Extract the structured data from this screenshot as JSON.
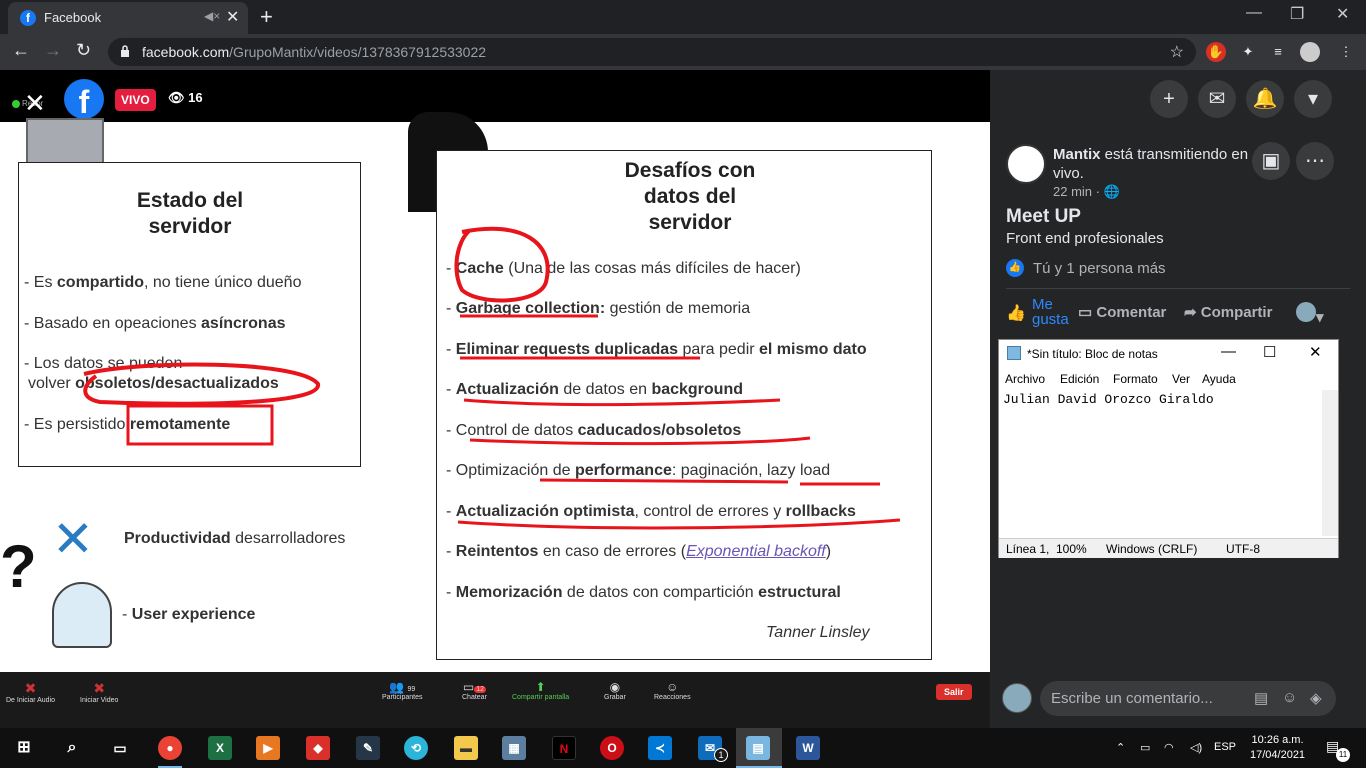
{
  "browser": {
    "tab_title": "Facebook",
    "url_domain": "facebook.com",
    "url_path": "/GrupoMantix/videos/1378367912533022"
  },
  "video": {
    "live_badge": "VIVO",
    "viewer_count": "16",
    "recording_label": "Recor"
  },
  "slide": {
    "left_title": "Estado del\nservidor",
    "left_items": [
      [
        "- Es ",
        "compartido",
        ", no tiene único dueño"
      ],
      [
        "- Basado en opeaciones ",
        "asíncronas",
        ""
      ],
      [
        "- Los datos se pueden",
        "",
        ""
      ],
      [
        "volver ",
        "obsoletos/desactualizados",
        ""
      ],
      [
        "- Es persistido ",
        "remotamente",
        ""
      ]
    ],
    "bottom_items": [
      [
        "",
        "Productividad",
        " desarrolladores"
      ],
      [
        "- ",
        "User experience",
        ""
      ]
    ],
    "right_title": "Desafíos con\ndatos del\nservidor",
    "right_items": [
      [
        "- ",
        "Cache",
        " (Una de las cosas más difíciles de hacer)",
        ""
      ],
      [
        "- ",
        "Garbage collection:",
        " gestión de memoria",
        ""
      ],
      [
        "- ",
        "Eliminar requests duplicadas",
        " para pedir ",
        "el mismo dato"
      ],
      [
        "- ",
        "Actualización",
        " de datos en ",
        "background"
      ],
      [
        "- ",
        "",
        "Control de datos ",
        "caducados/obsoletos"
      ],
      [
        "- ",
        "",
        "Optimización de ",
        "performance",
        ": paginación, lazy load"
      ],
      [
        "- ",
        "Actualización optimista",
        ", control de errores y ",
        "rollbacks"
      ],
      [
        "- ",
        "Reintentos",
        " en caso de errores (",
        "Exponential backoff",
        ")"
      ],
      [
        "- ",
        "Memorización",
        " de datos con compartición ",
        "estructural"
      ]
    ],
    "author": "Tanner Linsley"
  },
  "zoom_controls": {
    "items": [
      "De Iniciar Audio",
      "Iniciar Video",
      "Participantes",
      "Chatear",
      "Compartir pantalla",
      "Grabar",
      "Reacciones"
    ],
    "participants_count": "99",
    "chat_count": "12",
    "leave_label": "Salir"
  },
  "post": {
    "author": "Mantix",
    "author_suffix": " está transmitiendo en vivo.",
    "time": "22 min · ",
    "title": "Meet UP",
    "subtitle": "Front end profesionales",
    "reactions": "Tú y 1 persona más",
    "actions": {
      "like": "Me gusta",
      "comment": "Comentar",
      "share": "Compartir"
    },
    "comment_placeholder": "Escribe un comentario..."
  },
  "notepad": {
    "title": "*Sin título: Bloc de notas",
    "menu": [
      "Archivo",
      "Edición",
      "Formato",
      "Ver",
      "Ayuda"
    ],
    "content": "Julian David Orozco Giraldo",
    "status": [
      "Línea 1,",
      "100%",
      "Windows (CRLF)",
      "UTF-8"
    ]
  },
  "taskbar": {
    "language": "ESP",
    "time": "10:26 a.m.",
    "date": "17/04/2021",
    "notif_count": "11",
    "mail_count": "1"
  },
  "colors": {
    "fb_blue": "#1877f2",
    "live_red": "#e41e3f",
    "panel_bg": "#242526",
    "annotation_red": "#e8141b"
  }
}
